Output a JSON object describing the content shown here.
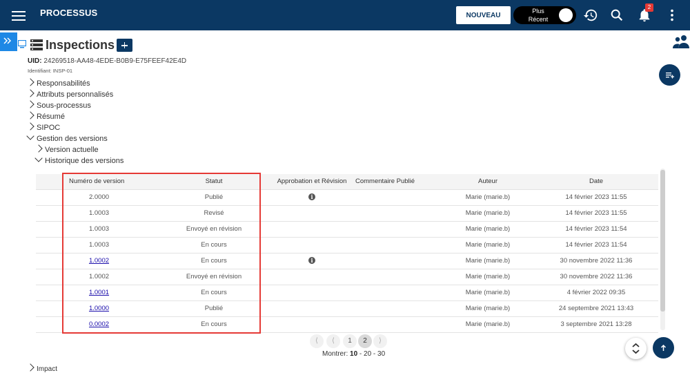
{
  "header": {
    "app_title": "PROCESSUS",
    "new_button": "NOUVEAU",
    "toggle_label_1": "Plus",
    "toggle_label_2": "Récent",
    "notification_count": "2",
    "colors": {
      "bar": "#0b3863",
      "badge": "#e53935"
    }
  },
  "page": {
    "title": "Inspections",
    "uid_label": "UID:",
    "uid_value": "24269518-AA48-4EDE-B0B9-E75FEEF42E4D",
    "identifiant": "Identifiant:  INSP-01"
  },
  "tree": {
    "responsabilites": "Responsabilités",
    "attributs": "Attributs personnalisés",
    "sous_processus": "Sous-processus",
    "resume": "Résumé",
    "sipoc": "SIPOC",
    "gestion": "Gestion des versions",
    "version_actuelle": "Version actuelle",
    "historique": "Historique des versions",
    "impact": "Impact"
  },
  "table": {
    "headers": {
      "version": "Numéro de version",
      "status": "Statut",
      "approval": "Approbation et Révision",
      "comment": "Commentaire Publié",
      "author": "Auteur",
      "date": "Date"
    },
    "rows": [
      {
        "version": "2.0000",
        "version_link": false,
        "status": "Publié",
        "approval_info": true,
        "author": "Marie (marie.b)",
        "date": "14 février 2023 11:55"
      },
      {
        "version": "1.0003",
        "version_link": false,
        "status": "Revisé",
        "approval_info": false,
        "author": "Marie (marie.b)",
        "date": "14 février 2023 11:55"
      },
      {
        "version": "1.0003",
        "version_link": false,
        "status": "Envoyé en révision",
        "approval_info": false,
        "author": "Marie (marie.b)",
        "date": "14 février 2023 11:54"
      },
      {
        "version": "1.0003",
        "version_link": false,
        "status": "En cours",
        "approval_info": false,
        "author": "Marie (marie.b)",
        "date": "14 février 2023 11:54"
      },
      {
        "version": "1.0002",
        "version_link": true,
        "status": "En cours",
        "approval_info": true,
        "author": "Marie (marie.b)",
        "date": "30 novembre 2022 11:36"
      },
      {
        "version": "1.0002",
        "version_link": false,
        "status": "Envoyé en révision",
        "approval_info": false,
        "author": "Marie (marie.b)",
        "date": "30 novembre 2022 11:36"
      },
      {
        "version": "1.0001",
        "version_link": true,
        "status": "En cours",
        "approval_info": false,
        "author": "Marie (marie.b)",
        "date": "4 février 2022 09:35"
      },
      {
        "version": "1.0000",
        "version_link": true,
        "status": "Publié",
        "approval_info": false,
        "author": "Marie (marie.b)",
        "date": "24 septembre 2021 13:43"
      },
      {
        "version": "0.0002",
        "version_link": true,
        "status": "En cours",
        "approval_info": false,
        "author": "Marie (marie.b)",
        "date": "3 septembre 2021 13:28"
      }
    ]
  },
  "pagination": {
    "pages": [
      "1",
      "2"
    ],
    "current_page": "2",
    "show_label": "Montrer:",
    "sizes": [
      "10",
      "20",
      "30"
    ],
    "separator": " - "
  },
  "icons": {
    "menu": "hamburger-icon",
    "history": "history-icon",
    "search": "search-icon",
    "bell": "bell-icon",
    "more": "more-vert-icon",
    "users": "users-icon",
    "info": "i"
  }
}
